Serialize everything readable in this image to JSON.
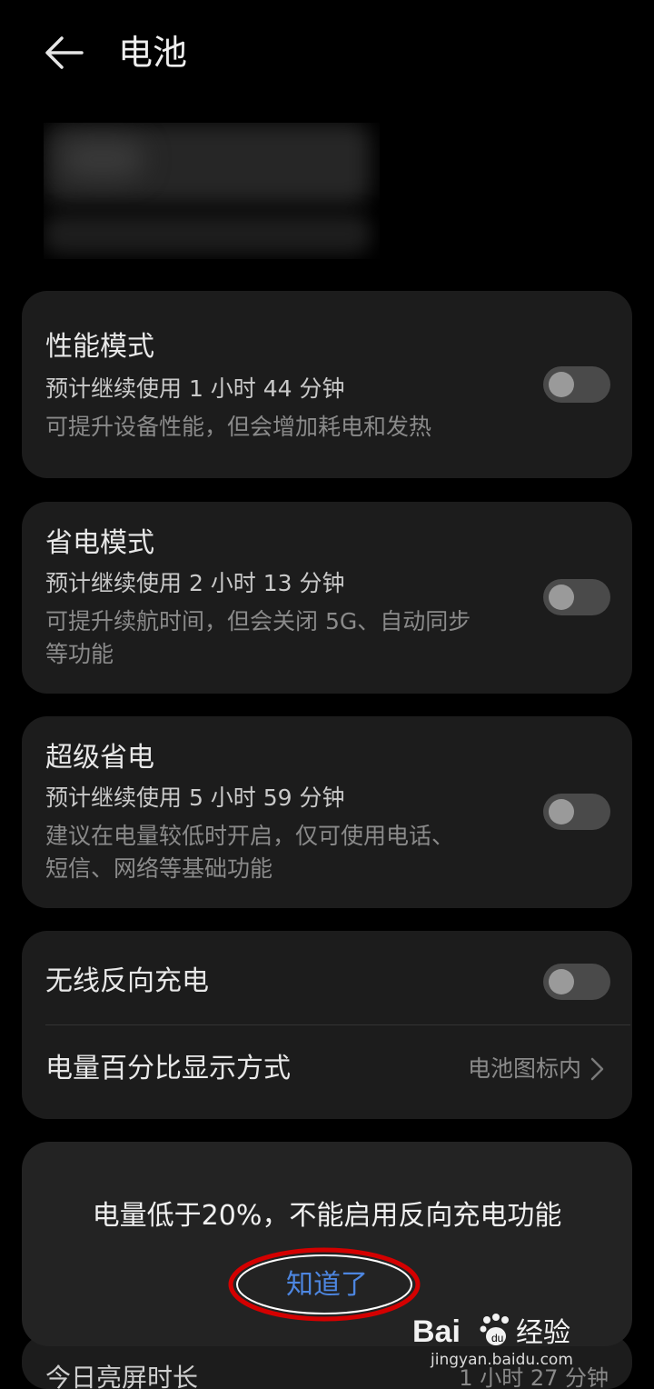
{
  "header": {
    "title": "电池"
  },
  "modes": [
    {
      "title": "性能模式",
      "estimate": "预计继续使用 1 小时 44 分钟",
      "desc": [
        "可提升设备性能，但会增加耗电和发热"
      ]
    },
    {
      "title": "省电模式",
      "estimate": "预计继续使用 2 小时 13 分钟",
      "desc": [
        "可提升续航时间，但会关闭 5G、自动同步",
        "等功能"
      ]
    },
    {
      "title": "超级省电",
      "estimate": "预计继续使用 5 小时 59 分钟",
      "desc": [
        "建议在电量较低时开启，仅可使用电话、",
        "短信、网络等基础功能"
      ]
    }
  ],
  "settings": {
    "wireless_reverse": {
      "label": "无线反向充电"
    },
    "percentage": {
      "label": "电量百分比显示方式",
      "value": "电池图标内"
    }
  },
  "dialog": {
    "message": "电量低于20%，不能启用反向充电功能",
    "ok": "知道了"
  },
  "bottom": {
    "label": "今日亮屏时长",
    "value": "1 小时 27 分钟"
  },
  "watermark": {
    "logo": "Baidu经验",
    "url": "jingyan.baidu.com"
  },
  "colors": {
    "background": "#000000",
    "card": "#1c1c1c",
    "accent": "#4d86e0",
    "highlight": "#d40000"
  }
}
